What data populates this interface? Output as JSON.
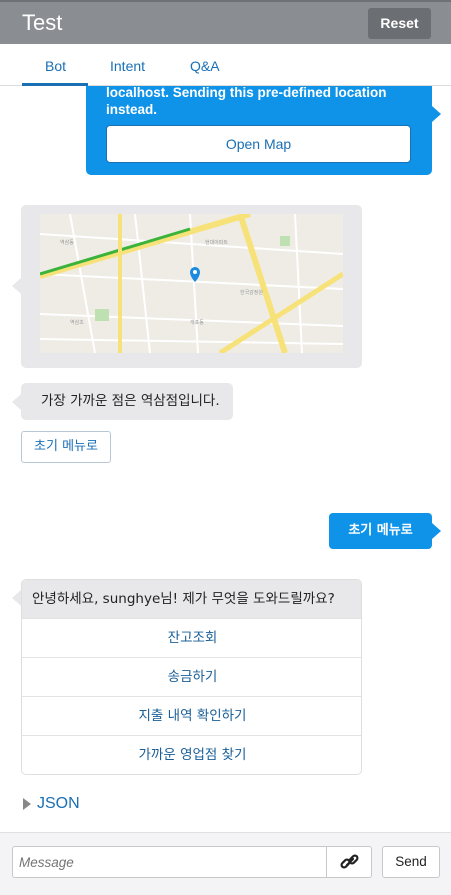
{
  "header": {
    "title": "Test",
    "reset_label": "Reset"
  },
  "tabs": [
    {
      "label": "Bot",
      "active": true
    },
    {
      "label": "Intent",
      "active": false
    },
    {
      "label": "Q&A",
      "active": false
    }
  ],
  "messages": {
    "location_notice": "localhost.  Sending this pre-defined location instead.",
    "open_map_label": "Open Map",
    "nearest_branch": "가장 가까운 점은 역삼점입니다.",
    "main_menu_button": "초기 메뉴로",
    "user_main_menu": "초기 메뉴로",
    "greeting": "안녕하세요, sunghye님! 제가 무엇을 도와드릴까요?",
    "options": [
      "잔고조회",
      "송금하기",
      "지출 내역 확인하기",
      "가까운 영업점 찾기"
    ]
  },
  "json_toggle": "JSON",
  "composer": {
    "placeholder": "Message",
    "send_label": "Send"
  },
  "colors": {
    "header": "#8a8d92",
    "accent": "#0e93e8",
    "link": "#1a6fb5",
    "bot_bubble": "#e8e8eb"
  },
  "icons": {
    "link": "link-icon",
    "map_pin": "map-pin-icon",
    "expand": "triangle-right-icon"
  }
}
